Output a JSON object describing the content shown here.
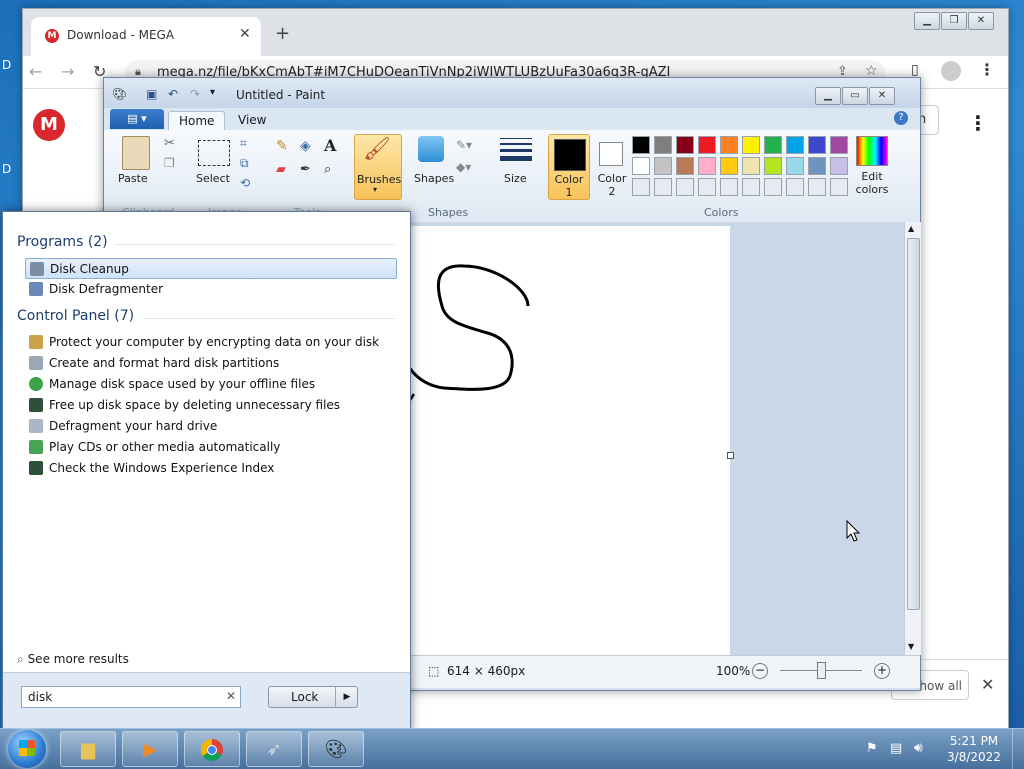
{
  "chrome": {
    "tab_title": "Download - MEGA",
    "tab_icon_letter": "M",
    "url": "mega.nz/file/bKxCmAbT#iM7CHuDOeanTiVnNp2iWIWTLUBzUuFa30a6q3R-gAZI",
    "show_all_label": "Show all",
    "mega_logo_letter": "M",
    "partial_button_text": "n"
  },
  "paint": {
    "title": "Untitled - Paint",
    "tabs": [
      "Home",
      "View"
    ],
    "clipboard": {
      "paste": "Paste",
      "group": "Clipboard"
    },
    "image": {
      "select": "Select",
      "group": "Image"
    },
    "tools_group": "Tools",
    "brushes": "Brushes",
    "shapes": {
      "label": "Shapes",
      "group": "Shapes"
    },
    "size": "Size",
    "color1": {
      "label": "Color",
      "num": "1"
    },
    "color2": {
      "label": "Color",
      "num": "2"
    },
    "colors_group": "Colors",
    "edit_colors": {
      "line1": "Edit",
      "line2": "colors"
    },
    "palette_row1": [
      "#000000",
      "#7f7f7f",
      "#880015",
      "#ed1c24",
      "#ff7f27",
      "#fff200",
      "#22b14c",
      "#00a2e8",
      "#3f48cc",
      "#a349a4"
    ],
    "palette_row2": [
      "#ffffff",
      "#c3c3c3",
      "#b97a57",
      "#ffaec9",
      "#ffc90e",
      "#efe4b0",
      "#b5e61d",
      "#99d9ea",
      "#7092be",
      "#c8bfe7"
    ],
    "status_size": "614 × 460px",
    "zoom": "100%"
  },
  "startmenu": {
    "programs_header": "Programs (2)",
    "programs": [
      "Disk Cleanup",
      "Disk Defragmenter"
    ],
    "control_header": "Control Panel (7)",
    "control_items": [
      "Protect your computer by encrypting data on your disk",
      "Create and format hard disk partitions",
      "Manage disk space used by your offline files",
      "Free up disk space by deleting unnecessary files",
      "Defragment your hard drive",
      "Play CDs or other media automatically",
      "Check the Windows Experience Index"
    ],
    "see_more": "See more results",
    "search_value": "disk",
    "lock_label": "Lock"
  },
  "taskbar": {
    "time": "5:21 PM",
    "date": "3/8/2022"
  },
  "desktop_fragments": {
    "a": "D",
    "b": "D"
  }
}
